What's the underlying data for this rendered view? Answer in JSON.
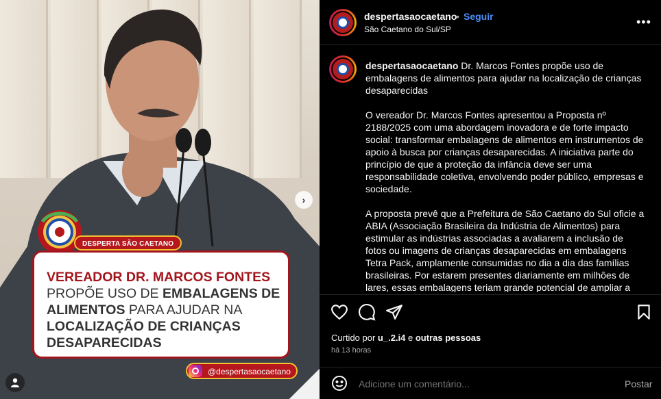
{
  "header": {
    "username": "despertasaocaetano",
    "separator": "•",
    "follow_label": "Seguir",
    "location": "São Caetano do Sul/SP",
    "more_label": "•••"
  },
  "media": {
    "badge_label": "DESPERTA SÃO CAETANO",
    "card_line1": "VEREADOR DR. MARCOS FONTES",
    "card_line2_a": "PROPÕE USO DE ",
    "card_line2_b": "EMBALAGENS DE",
    "card_line3_a": "ALIMENTOS",
    "card_line3_b": " PARA AJUDAR NA",
    "card_line4": "LOCALIZAÇÃO DE CRIANÇAS",
    "card_line5": "DESAPARECIDAS",
    "handle": "@despertasaocaetano",
    "next_icon": "›"
  },
  "caption": {
    "username": "despertasaocaetano",
    "title": " Dr. Marcos Fontes propõe uso de embalagens de alimentos para ajudar na localização de crianças desaparecidas",
    "paragraph1": "O vereador Dr. Marcos Fontes apresentou a Proposta nº 2188/2025 com uma abordagem inovadora e de forte impacto social: transformar embalagens de alimentos em instrumentos de apoio à busca por crianças desaparecidas. A iniciativa parte do princípio de que a proteção da infância deve ser uma responsabilidade coletiva, envolvendo poder público, empresas e sociedade.",
    "paragraph2": "A proposta prevê que a Prefeitura de São Caetano do Sul oficie a ABIA (Associação Brasileira da Indústria de Alimentos) para estimular as indústrias associadas a avaliarem a inclusão de fotos ou imagens de crianças desaparecidas em embalagens Tetra Pack, amplamente consumidas no dia a dia das famílias brasileiras. Por estarem presentes diariamente em milhões de lares, essas embalagens teriam grande potencial de ampliar a"
  },
  "actions": {
    "icons": [
      "heart-icon",
      "comment-icon",
      "share-icon",
      "bookmark-icon"
    ]
  },
  "likes": {
    "prefix": "Curtido por ",
    "user": "u_.2.i4",
    "middle": " e ",
    "others": "outras pessoas"
  },
  "time": "há 13 horas",
  "comment": {
    "placeholder": "Adicione um comentário...",
    "post_label": "Postar"
  },
  "colors": {
    "brand_red": "#a3151c",
    "follow_blue": "#4f8ef7",
    "badge_gold": "#f1c232"
  }
}
